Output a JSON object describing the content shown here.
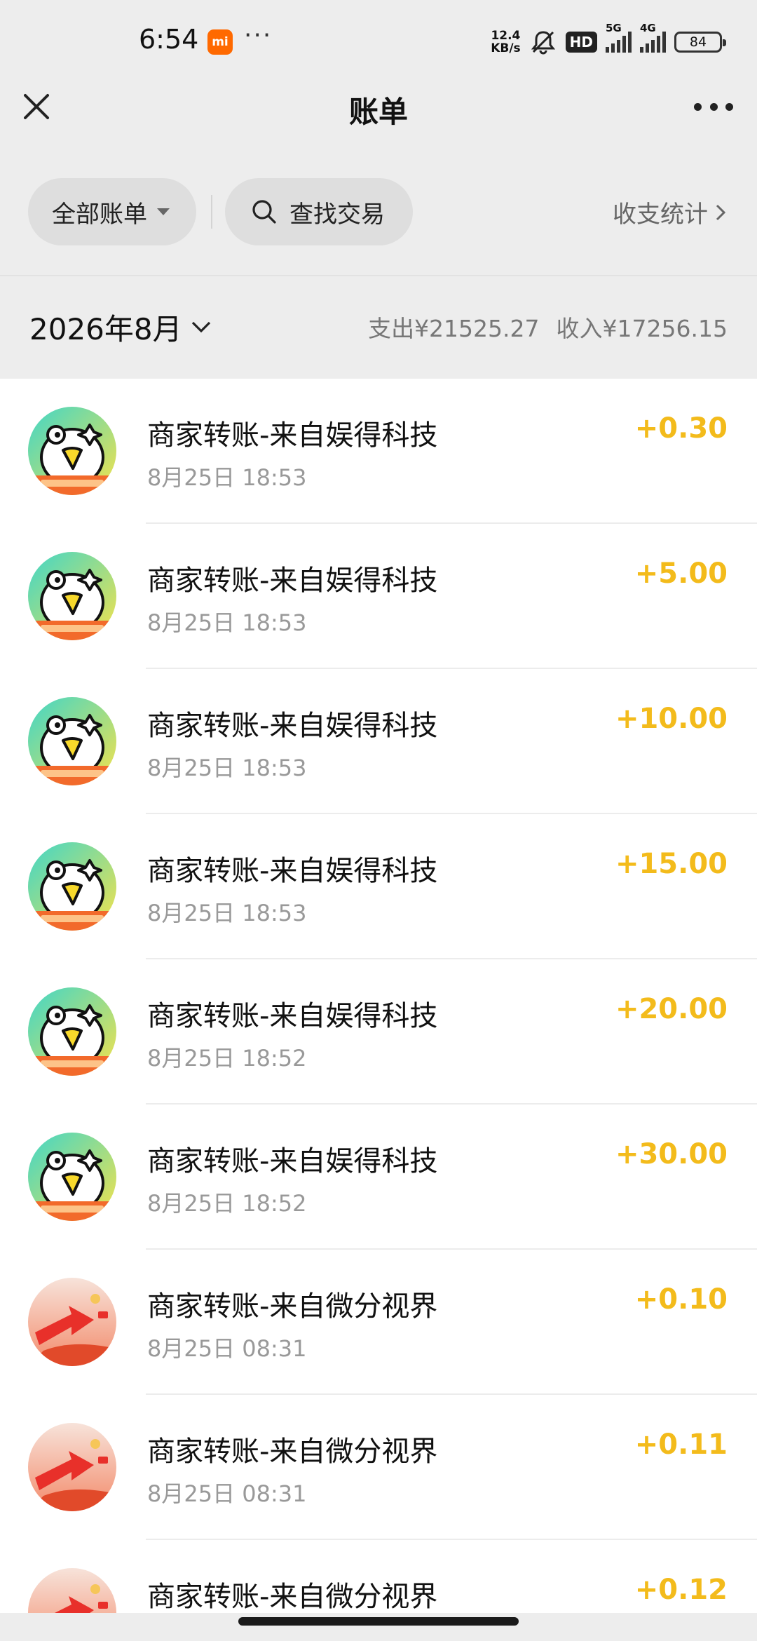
{
  "status_bar": {
    "time": "6:54",
    "mi_label": "mi",
    "dots": "···",
    "net_speed_value": "12.4",
    "net_speed_unit": "KB/s",
    "hd_label": "HD",
    "signal_1_label": "5G",
    "signal_2_label": "4G",
    "battery": "84"
  },
  "nav": {
    "title": "账单"
  },
  "filters": {
    "all_bills": "全部账单",
    "search": "查找交易",
    "stats": "收支统计"
  },
  "month": {
    "label": "2026年8月",
    "expense": "支出¥21525.27",
    "income": "收入¥17256.15"
  },
  "transactions": [
    {
      "title": "商家转账-来自娱得科技",
      "time": "8月25日 18:53",
      "amount": "+0.30",
      "avatar": "duck"
    },
    {
      "title": "商家转账-来自娱得科技",
      "time": "8月25日 18:53",
      "amount": "+5.00",
      "avatar": "duck"
    },
    {
      "title": "商家转账-来自娱得科技",
      "time": "8月25日 18:53",
      "amount": "+10.00",
      "avatar": "duck"
    },
    {
      "title": "商家转账-来自娱得科技",
      "time": "8月25日 18:53",
      "amount": "+15.00",
      "avatar": "duck"
    },
    {
      "title": "商家转账-来自娱得科技",
      "time": "8月25日 18:52",
      "amount": "+20.00",
      "avatar": "duck"
    },
    {
      "title": "商家转账-来自娱得科技",
      "time": "8月25日 18:52",
      "amount": "+30.00",
      "avatar": "duck"
    },
    {
      "title": "商家转账-来自微分视界",
      "time": "8月25日 08:31",
      "amount": "+0.10",
      "avatar": "arrow"
    },
    {
      "title": "商家转账-来自微分视界",
      "time": "8月25日 08:31",
      "amount": "+0.11",
      "avatar": "arrow"
    },
    {
      "title": "商家转账-来自微分视界",
      "time": "",
      "amount": "+0.12",
      "avatar": "arrow"
    }
  ],
  "colors": {
    "income_amount": "#f3bb1b",
    "page_bg": "#ededed",
    "list_bg": "#ffffff"
  }
}
